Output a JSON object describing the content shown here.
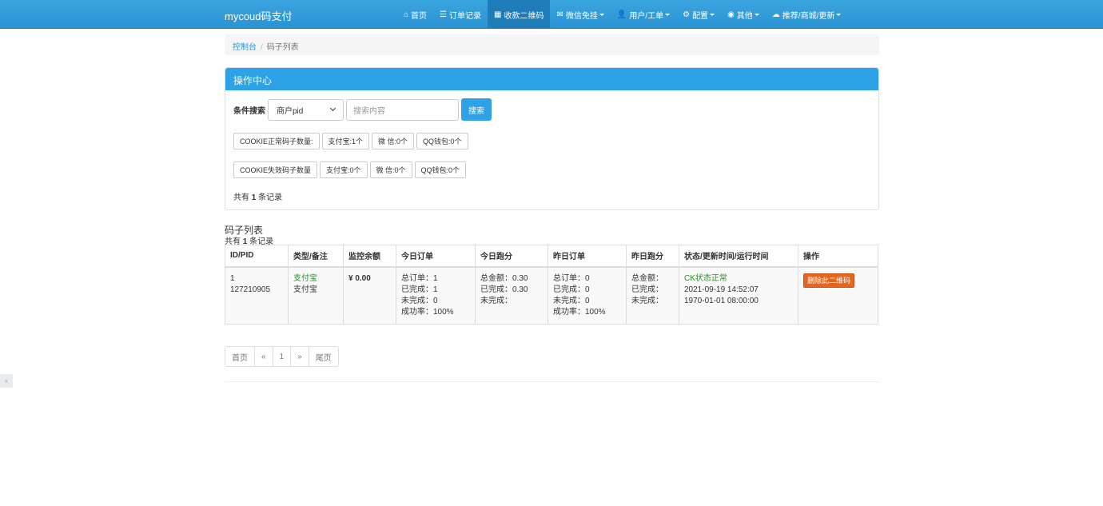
{
  "navbar": {
    "brand": "mycoud码支付",
    "items": [
      {
        "label": "首页",
        "icon": "⌂"
      },
      {
        "label": "订单记录",
        "icon": "☰"
      },
      {
        "label": "收款二维码",
        "icon": "▦"
      },
      {
        "label": "微信免挂",
        "icon": "✉"
      },
      {
        "label": "用户/工单",
        "icon": "👤"
      },
      {
        "label": "配置",
        "icon": "⚙"
      },
      {
        "label": "其他",
        "icon": "◉"
      },
      {
        "label": "推荐/商城/更新",
        "icon": "☁"
      }
    ]
  },
  "breadcrumb": {
    "home": "控制台",
    "sep": "/",
    "current": "码子列表"
  },
  "panel": {
    "title": "操作中心",
    "search_label": "条件搜索",
    "select_value": "商户pid",
    "input_placeholder": "搜索内容",
    "search_button": "搜索",
    "cookie_ok": [
      "COOKIE正常码子数量:",
      "支付宝:1个",
      "微 信:0个",
      "QQ钱包:0个"
    ],
    "cookie_bad": [
      "COOKIE失效码子数量",
      "支付宝:0个",
      "微 信:0个",
      "QQ钱包:0个"
    ],
    "total_prefix": "共有 ",
    "total_count": "1",
    "total_suffix": " 条记录"
  },
  "list": {
    "title": "码子列表",
    "count_prefix": "共有 ",
    "count": "1",
    "count_suffix": " 条记录",
    "headers": [
      "ID/PID",
      "类型/备注",
      "监控余额",
      "今日订单",
      "今日跑分",
      "昨日订单",
      "昨日跑分",
      "状态/更新时间/运行时间",
      "操作"
    ],
    "row": {
      "id": "1",
      "pid": "127210905",
      "type": "支付宝",
      "remark": "支付宝",
      "balance": "¥ 0.00",
      "today_orders": [
        "总订单：1",
        "已完成：1",
        "未完成：0",
        "成功率：100%"
      ],
      "today_score": [
        "总金额：0.30",
        "已完成：0.30",
        "未完成："
      ],
      "yesterday_orders": [
        "总订单：0",
        "已完成：0",
        "未完成：0",
        "成功率：100%"
      ],
      "yesterday_score": [
        "总金额：",
        "已完成：",
        "未完成："
      ],
      "status": "CK状态正常",
      "updated": "2021-09-19 14:52:07",
      "runtime": "1970-01-01 08:00:00",
      "action": "删除此二维码"
    }
  },
  "pagination": [
    "首页",
    "«",
    "1",
    "»",
    "尾页"
  ],
  "side_tab": "«",
  "colors": {
    "primary": "#2ea2e6",
    "danger": "#e6661f",
    "success": "#2e8b2e"
  }
}
